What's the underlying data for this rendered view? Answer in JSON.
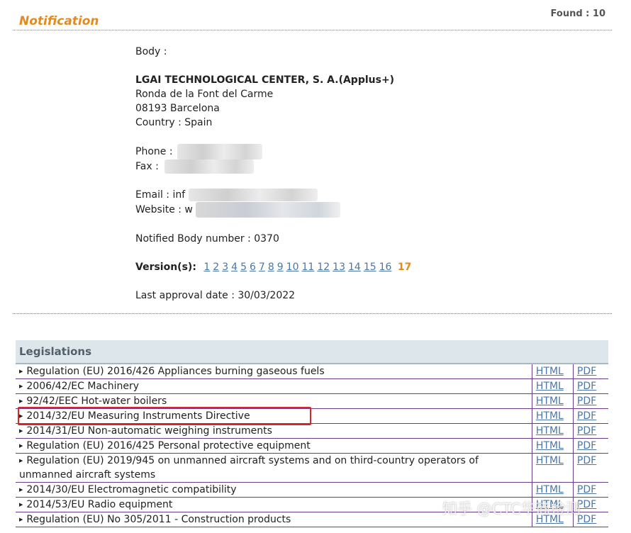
{
  "header": {
    "title": "Notification",
    "found_label": "Found : 10"
  },
  "body": {
    "label": "Body :",
    "organization": "LGAI TECHNOLOGICAL CENTER, S. A.(Applus+)",
    "address_line1": "Ronda de la Font del Carme",
    "address_line2": "08193 Barcelona",
    "country": "Country : Spain",
    "phone_label": "Phone :",
    "fax_label": "Fax :",
    "email_label": "Email : inf",
    "website_label": "Website : w",
    "notified_body": "Notified Body number : 0370",
    "versions_label": "Version(s):",
    "versions": [
      "1",
      "2",
      "3",
      "4",
      "5",
      "6",
      "7",
      "8",
      "9",
      "10",
      "11",
      "12",
      "13",
      "14",
      "15",
      "16"
    ],
    "current_version": "17",
    "last_approval": "Last approval date : 30/03/2022"
  },
  "legislations": {
    "header": "Legislations",
    "html_label": "HTML",
    "pdf_label": "PDF",
    "rows": [
      "Regulation (EU) 2016/426 Appliances burning gaseous fuels",
      "2006/42/EC Machinery",
      "92/42/EEC Hot-water boilers",
      "2014/32/EU Measuring Instruments Directive",
      "2014/31/EU Non-automatic weighing instruments",
      "Regulation (EU) 2016/425 Personal protective equipment",
      "Regulation (EU) 2019/945 on unmanned aircraft systems and on third-country operators of unmanned aircraft systems",
      "2014/30/EU Electromagnetic compatibility",
      "2014/53/EU Radio equipment",
      "Regulation (EU) No 305/2011 - Construction products"
    ]
  },
  "watermark": "知乎 @CTC华商检测"
}
